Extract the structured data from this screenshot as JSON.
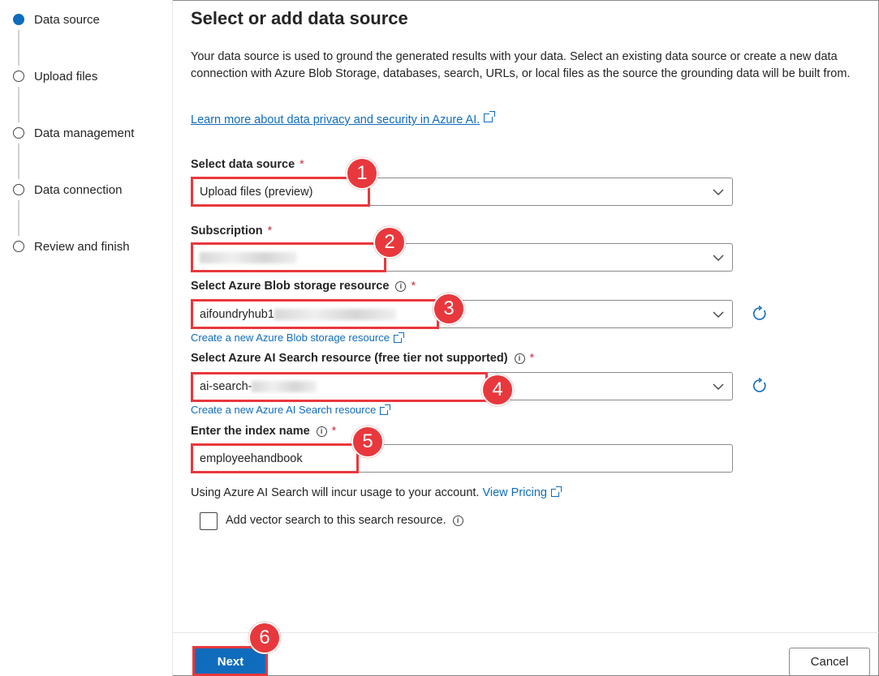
{
  "stepper": {
    "steps": [
      {
        "label": "Data source",
        "active": true
      },
      {
        "label": "Upload files",
        "active": false
      },
      {
        "label": "Data management",
        "active": false
      },
      {
        "label": "Data connection",
        "active": false
      },
      {
        "label": "Review and finish",
        "active": false
      }
    ]
  },
  "main": {
    "title": "Select or add data source",
    "description": "Your data source is used to ground the generated results with your data. Select an existing data source or create a new data connection with Azure Blob Storage, databases, search, URLs, or local files as the source the grounding data will be built from.",
    "learn_more": "Learn more about data privacy and security in Azure AI."
  },
  "fields": {
    "data_source": {
      "label": "Select data source",
      "required": "*",
      "value": "Upload files (preview)"
    },
    "subscription": {
      "label": "Subscription",
      "required": "*",
      "value": ""
    },
    "blob": {
      "label": "Select Azure Blob storage resource",
      "info": "i",
      "required": "*",
      "value": "aifoundryhub1",
      "create_link": "Create a new Azure Blob storage resource"
    },
    "search": {
      "label": "Select Azure AI Search resource (free tier not supported)",
      "info": "i",
      "required": "*",
      "value": "ai-search-",
      "create_link": "Create a new Azure AI Search resource"
    },
    "index": {
      "label": "Enter the index name",
      "info": "i",
      "required": "*",
      "value": "employeehandbook"
    }
  },
  "pricing_note": {
    "text": "Using Azure AI Search will incur usage to your account.",
    "link": "View Pricing"
  },
  "vector_search": {
    "label": "Add vector search to this search resource.",
    "info": "i",
    "checked": false
  },
  "footer": {
    "next_label": "Next",
    "cancel_label": "Cancel"
  },
  "callouts": [
    "1",
    "2",
    "3",
    "4",
    "5",
    "6"
  ],
  "colors": {
    "accent": "#0f6cbd",
    "callout": "#e8383d",
    "required": "#c4314b"
  }
}
